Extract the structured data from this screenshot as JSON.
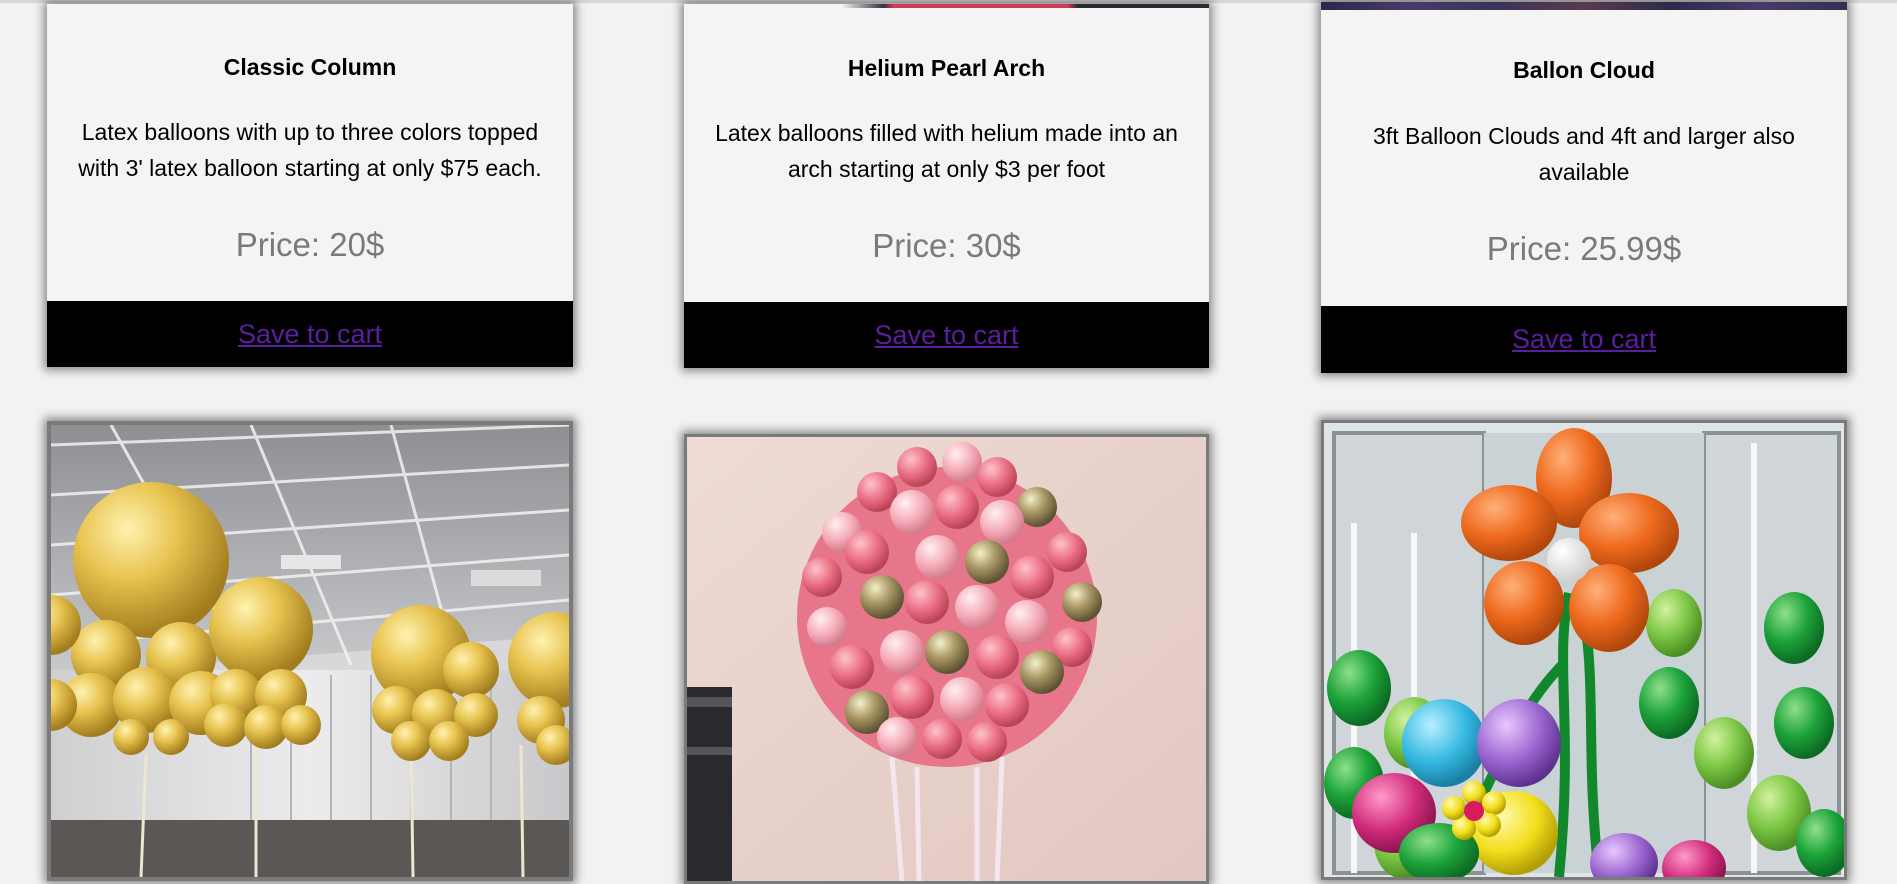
{
  "products": [
    {
      "title": "Classic Column",
      "description": "Latex balloons with up to three colors topped with 3' latex balloon starting at only $75 each.",
      "price": "Price: 20$",
      "cart_label": "Save to cart"
    },
    {
      "title": "Helium Pearl Arch",
      "description": "Latex balloons filled with helium made into an arch starting at only $3 per foot",
      "price": "Price: 30$",
      "cart_label": "Save to cart"
    },
    {
      "title": "Ballon Cloud",
      "description": "3ft Balloon Clouds and 4ft and larger also available",
      "price": "Price: 25.99$",
      "cart_label": "Save to cart"
    }
  ],
  "photos": [
    {
      "subject": "gold-balloon-columns"
    },
    {
      "subject": "pink-gold-balloon-ball"
    },
    {
      "subject": "balloon-flower-bouquet"
    }
  ],
  "colors": {
    "page_background": "#f2f2f2",
    "card_background": "#f4f4f4",
    "cart_bar": "#000000",
    "cart_link": "#5b1ea0",
    "price_text": "#7a7a7a"
  }
}
